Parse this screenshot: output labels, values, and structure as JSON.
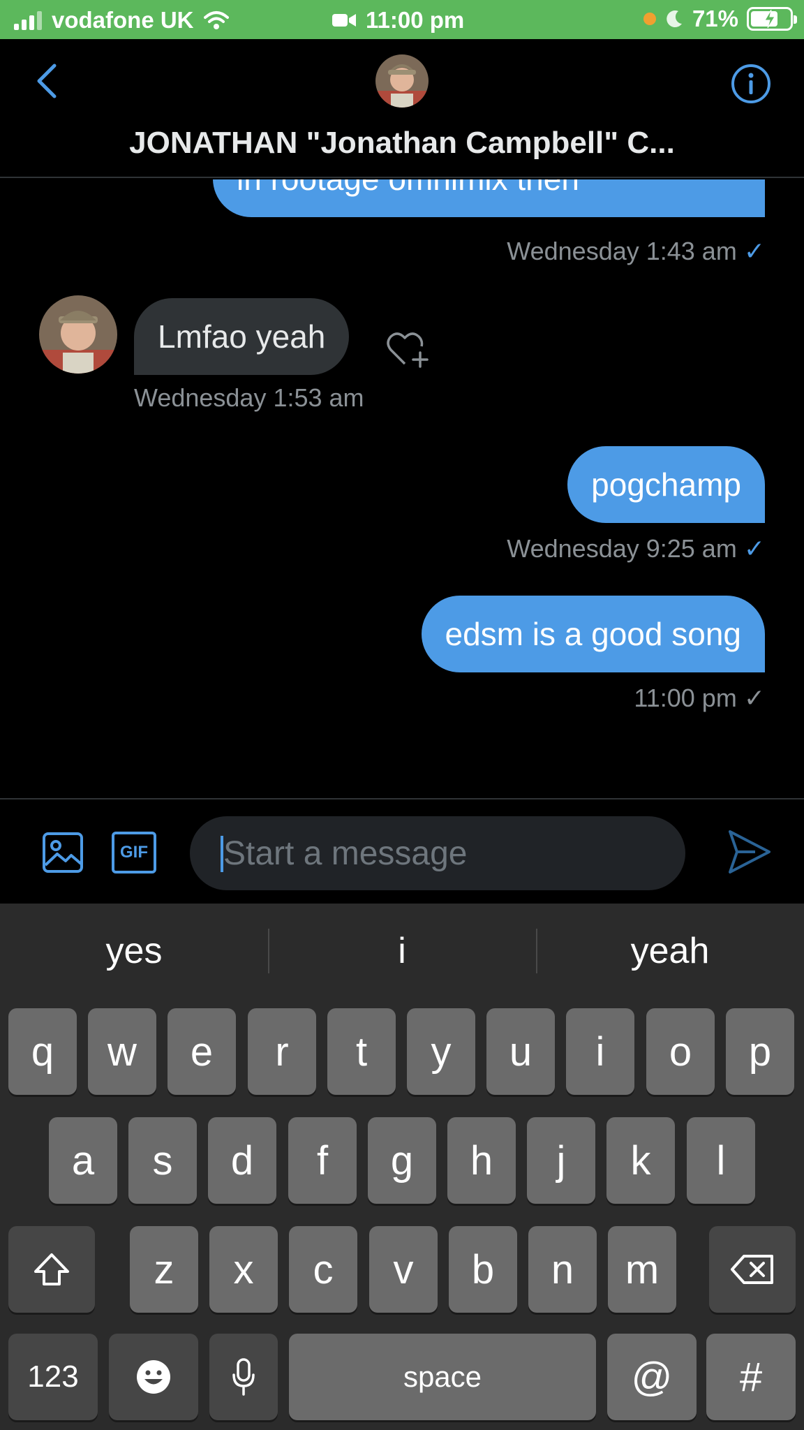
{
  "status_bar": {
    "carrier": "vodafone UK",
    "time": "11:00 pm",
    "battery": "71%",
    "battery_level": 0.71
  },
  "header": {
    "title": "JONATHAN \"Jonathan Campbell\" C..."
  },
  "messages": [
    {
      "direction": "out",
      "text": "in rootage omnimix then",
      "timestamp": "Wednesday 1:43 am",
      "read": true
    },
    {
      "direction": "in",
      "text": "Lmfao yeah",
      "timestamp": "Wednesday 1:53 am"
    },
    {
      "direction": "out",
      "text": "pogchamp",
      "timestamp": "Wednesday 9:25 am",
      "read": true
    },
    {
      "direction": "out",
      "text": "edsm is a good song",
      "timestamp": "11:00 pm",
      "read": false
    }
  ],
  "composer": {
    "placeholder": "Start a message",
    "gif_label": "GIF"
  },
  "keyboard": {
    "suggestions": [
      "yes",
      "i",
      "yeah"
    ],
    "row1": [
      "q",
      "w",
      "e",
      "r",
      "t",
      "y",
      "u",
      "i",
      "o",
      "p"
    ],
    "row2": [
      "a",
      "s",
      "d",
      "f",
      "g",
      "h",
      "j",
      "k",
      "l"
    ],
    "row3": [
      "z",
      "x",
      "c",
      "v",
      "b",
      "n",
      "m"
    ],
    "numbers_label": "123",
    "space_label": "space",
    "at_label": "@",
    "hash_label": "#"
  },
  "colors": {
    "accent": "#4d9be6",
    "status_bar": "#5cb85c",
    "incoming_bubble": "#2f3336"
  },
  "icons": [
    "back-chevron-icon",
    "info-icon",
    "heart-plus-icon",
    "image-icon",
    "gif-icon",
    "send-icon",
    "shift-icon",
    "backspace-icon",
    "emoji-icon",
    "microphone-icon",
    "wifi-icon",
    "video-camera-icon",
    "moon-icon"
  ]
}
